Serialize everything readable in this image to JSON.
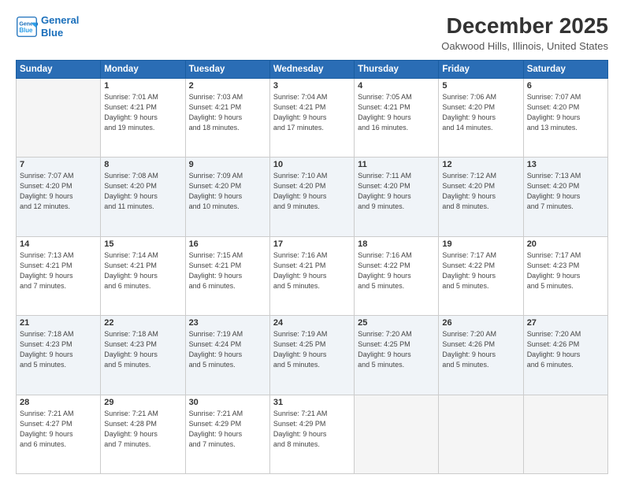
{
  "header": {
    "logo_line1": "General",
    "logo_line2": "Blue",
    "title": "December 2025",
    "subtitle": "Oakwood Hills, Illinois, United States"
  },
  "days_of_week": [
    "Sunday",
    "Monday",
    "Tuesday",
    "Wednesday",
    "Thursday",
    "Friday",
    "Saturday"
  ],
  "weeks": [
    [
      {
        "num": "",
        "info": ""
      },
      {
        "num": "1",
        "info": "Sunrise: 7:01 AM\nSunset: 4:21 PM\nDaylight: 9 hours\nand 19 minutes."
      },
      {
        "num": "2",
        "info": "Sunrise: 7:03 AM\nSunset: 4:21 PM\nDaylight: 9 hours\nand 18 minutes."
      },
      {
        "num": "3",
        "info": "Sunrise: 7:04 AM\nSunset: 4:21 PM\nDaylight: 9 hours\nand 17 minutes."
      },
      {
        "num": "4",
        "info": "Sunrise: 7:05 AM\nSunset: 4:21 PM\nDaylight: 9 hours\nand 16 minutes."
      },
      {
        "num": "5",
        "info": "Sunrise: 7:06 AM\nSunset: 4:20 PM\nDaylight: 9 hours\nand 14 minutes."
      },
      {
        "num": "6",
        "info": "Sunrise: 7:07 AM\nSunset: 4:20 PM\nDaylight: 9 hours\nand 13 minutes."
      }
    ],
    [
      {
        "num": "7",
        "info": "Sunrise: 7:07 AM\nSunset: 4:20 PM\nDaylight: 9 hours\nand 12 minutes."
      },
      {
        "num": "8",
        "info": "Sunrise: 7:08 AM\nSunset: 4:20 PM\nDaylight: 9 hours\nand 11 minutes."
      },
      {
        "num": "9",
        "info": "Sunrise: 7:09 AM\nSunset: 4:20 PM\nDaylight: 9 hours\nand 10 minutes."
      },
      {
        "num": "10",
        "info": "Sunrise: 7:10 AM\nSunset: 4:20 PM\nDaylight: 9 hours\nand 9 minutes."
      },
      {
        "num": "11",
        "info": "Sunrise: 7:11 AM\nSunset: 4:20 PM\nDaylight: 9 hours\nand 9 minutes."
      },
      {
        "num": "12",
        "info": "Sunrise: 7:12 AM\nSunset: 4:20 PM\nDaylight: 9 hours\nand 8 minutes."
      },
      {
        "num": "13",
        "info": "Sunrise: 7:13 AM\nSunset: 4:20 PM\nDaylight: 9 hours\nand 7 minutes."
      }
    ],
    [
      {
        "num": "14",
        "info": "Sunrise: 7:13 AM\nSunset: 4:21 PM\nDaylight: 9 hours\nand 7 minutes."
      },
      {
        "num": "15",
        "info": "Sunrise: 7:14 AM\nSunset: 4:21 PM\nDaylight: 9 hours\nand 6 minutes."
      },
      {
        "num": "16",
        "info": "Sunrise: 7:15 AM\nSunset: 4:21 PM\nDaylight: 9 hours\nand 6 minutes."
      },
      {
        "num": "17",
        "info": "Sunrise: 7:16 AM\nSunset: 4:21 PM\nDaylight: 9 hours\nand 5 minutes."
      },
      {
        "num": "18",
        "info": "Sunrise: 7:16 AM\nSunset: 4:22 PM\nDaylight: 9 hours\nand 5 minutes."
      },
      {
        "num": "19",
        "info": "Sunrise: 7:17 AM\nSunset: 4:22 PM\nDaylight: 9 hours\nand 5 minutes."
      },
      {
        "num": "20",
        "info": "Sunrise: 7:17 AM\nSunset: 4:23 PM\nDaylight: 9 hours\nand 5 minutes."
      }
    ],
    [
      {
        "num": "21",
        "info": "Sunrise: 7:18 AM\nSunset: 4:23 PM\nDaylight: 9 hours\nand 5 minutes."
      },
      {
        "num": "22",
        "info": "Sunrise: 7:18 AM\nSunset: 4:23 PM\nDaylight: 9 hours\nand 5 minutes."
      },
      {
        "num": "23",
        "info": "Sunrise: 7:19 AM\nSunset: 4:24 PM\nDaylight: 9 hours\nand 5 minutes."
      },
      {
        "num": "24",
        "info": "Sunrise: 7:19 AM\nSunset: 4:25 PM\nDaylight: 9 hours\nand 5 minutes."
      },
      {
        "num": "25",
        "info": "Sunrise: 7:20 AM\nSunset: 4:25 PM\nDaylight: 9 hours\nand 5 minutes."
      },
      {
        "num": "26",
        "info": "Sunrise: 7:20 AM\nSunset: 4:26 PM\nDaylight: 9 hours\nand 5 minutes."
      },
      {
        "num": "27",
        "info": "Sunrise: 7:20 AM\nSunset: 4:26 PM\nDaylight: 9 hours\nand 6 minutes."
      }
    ],
    [
      {
        "num": "28",
        "info": "Sunrise: 7:21 AM\nSunset: 4:27 PM\nDaylight: 9 hours\nand 6 minutes."
      },
      {
        "num": "29",
        "info": "Sunrise: 7:21 AM\nSunset: 4:28 PM\nDaylight: 9 hours\nand 7 minutes."
      },
      {
        "num": "30",
        "info": "Sunrise: 7:21 AM\nSunset: 4:29 PM\nDaylight: 9 hours\nand 7 minutes."
      },
      {
        "num": "31",
        "info": "Sunrise: 7:21 AM\nSunset: 4:29 PM\nDaylight: 9 hours\nand 8 minutes."
      },
      {
        "num": "",
        "info": ""
      },
      {
        "num": "",
        "info": ""
      },
      {
        "num": "",
        "info": ""
      }
    ]
  ]
}
